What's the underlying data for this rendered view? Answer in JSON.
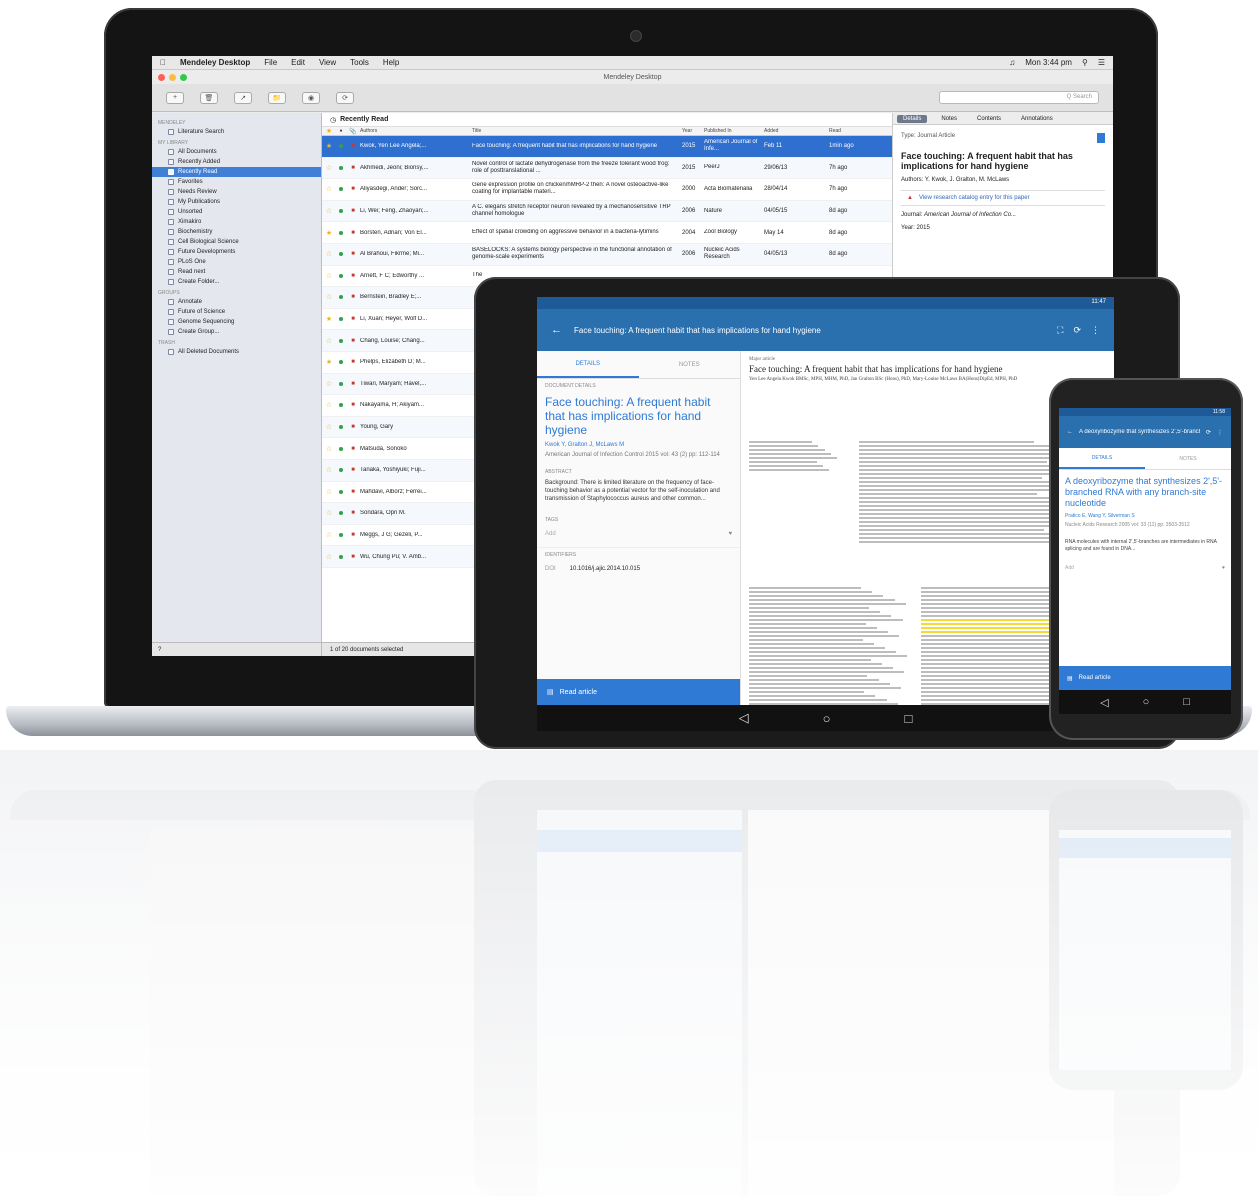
{
  "laptop": {
    "menubar": {
      "app_name": "Mendeley Desktop",
      "menus": [
        "File",
        "Edit",
        "View",
        "Tools",
        "Help"
      ],
      "clock": "Mon 3:44 pm"
    },
    "window_title": "Mendeley Desktop",
    "toolbar": {
      "search_placeholder": "Q Search",
      "labels": [
        "Documents",
        "Folders",
        "Related",
        "Sync"
      ]
    },
    "sidebar": {
      "mendeley_head": "MENDELEY",
      "literature_search": "Literature Search",
      "library_head": "MY LIBRARY",
      "items": [
        "All Documents",
        "Recently Added",
        "Recently Read",
        "Favorites",
        "Needs Review",
        "My Publications",
        "Unsorted",
        "Ximakiro",
        "Biochemistry",
        "Cell Biological Science",
        "Future Developments",
        "PLoS One",
        "Read next",
        "Create Folder..."
      ],
      "selected_index": 2,
      "groups_head": "GROUPS",
      "groups": [
        "Annotate",
        "Future of Science",
        "Genome Sequencing",
        "Create Group..."
      ],
      "trash_head": "TRASH",
      "trash_item": "All Deleted Documents"
    },
    "doclist": {
      "title": "Recently Read",
      "columns": [
        "Authors",
        "Title",
        "Year",
        "Published In",
        "Added",
        "Read"
      ],
      "rows": [
        {
          "author": "Kwok, Yen Lee Angela;...",
          "title": "Face touching: A frequent habit that has implications for hand hygiene",
          "year": "2015",
          "pub": "American Journal of Infe...",
          "added": "Feb 11",
          "read": "1min ago",
          "star": true
        },
        {
          "author": "Akhmedi, Jeoni; Bionsy,...",
          "title": "Novel control of lactate dehydrogenase from the freeze tolerant wood frog: role of posttranslational ...",
          "year": "2015",
          "pub": "PeerJ",
          "added": "29/06/13",
          "read": "7h ago",
          "star": false
        },
        {
          "author": "Aliyasdegi, Ander; Sorc...",
          "title": "Gene expression profile on chicken/hMRP-2 then: A novel osteoactive-like coating for implantable materi...",
          "year": "2000",
          "pub": "Acta Biomaterialia",
          "added": "28/04/14",
          "read": "7h ago",
          "star": false
        },
        {
          "author": "Li, Wei; Feng, Zhaoyan;...",
          "title": "A C. elegans stretch receptor neuron revealed by a mechanosensitive TRP channel homologue",
          "year": "2006",
          "pub": "Nature",
          "added": "04/05/15",
          "read": "8d ago",
          "star": false
        },
        {
          "author": "Borsten, Adrian; Von El...",
          "title": "Effect of spatial crowding on aggressive behavior in a bacteria-lytimins",
          "year": "2004",
          "pub": "Zool Biology",
          "added": "May 14",
          "read": "8d ago",
          "star": true
        },
        {
          "author": "Al Brahoui, Fikrme; Mi...",
          "title": "BASELOCKS: A systems biology perspective in the functional annotation of genome-scale experiments",
          "year": "2006",
          "pub": "Nucleic Acids Research",
          "added": "04/05/13",
          "read": "8d ago",
          "star": false
        },
        {
          "author": "Arnett, F C; Edworthy ...",
          "title": "The",
          "year": "",
          "pub": "",
          "added": "",
          "read": "",
          "star": false
        },
        {
          "author": "Bernstein, Bradley E;...",
          "title": "",
          "year": "",
          "pub": "",
          "added": "",
          "read": "",
          "star": false
        },
        {
          "author": "Li, Xuan; Heyer, Wolf D...",
          "title": "",
          "year": "",
          "pub": "",
          "added": "",
          "read": "",
          "star": true
        },
        {
          "author": "Chang, Louise; Chang...",
          "title": "",
          "year": "",
          "pub": "",
          "added": "",
          "read": "",
          "star": false
        },
        {
          "author": "Phelps, Elizabeth D; M...",
          "title": "",
          "year": "",
          "pub": "",
          "added": "",
          "read": "",
          "star": true
        },
        {
          "author": "Tiwari, Maryam; Havel,...",
          "title": "",
          "year": "",
          "pub": "",
          "added": "",
          "read": "",
          "star": false
        },
        {
          "author": "Nakayama, H; Akiyam...",
          "title": "",
          "year": "",
          "pub": "",
          "added": "",
          "read": "",
          "star": false
        },
        {
          "author": "Young, Gary",
          "title": "",
          "year": "",
          "pub": "",
          "added": "",
          "read": "",
          "star": false
        },
        {
          "author": "Matsuda, Sonoko",
          "title": "",
          "year": "",
          "pub": "",
          "added": "",
          "read": "",
          "star": false
        },
        {
          "author": "Tanaka, Yoshiyuki; Fuji...",
          "title": "",
          "year": "",
          "pub": "",
          "added": "",
          "read": "",
          "star": false
        },
        {
          "author": "Mahdavi, Alborz; Ferrei...",
          "title": "",
          "year": "",
          "pub": "",
          "added": "",
          "read": "",
          "star": false
        },
        {
          "author": "Sondara, Opri M.",
          "title": "",
          "year": "",
          "pub": "",
          "added": "",
          "read": "",
          "star": false
        },
        {
          "author": "Meggs, J G; Gezeli, P...",
          "title": "",
          "year": "",
          "pub": "",
          "added": "",
          "read": "",
          "star": false
        },
        {
          "author": "Wu, Chung Pu; V. Amb...",
          "title": "",
          "year": "",
          "pub": "",
          "added": "",
          "read": "",
          "star": false
        }
      ],
      "status": "1 of 20 documents selected"
    },
    "details": {
      "tabs": [
        "Details",
        "Notes",
        "Contents",
        "Annotations"
      ],
      "type_label": "Type:",
      "type_value": "Journal Article",
      "title": "Face touching: A frequent habit that has implications for hand hygiene",
      "authors_label": "Authors:",
      "authors_value": "Y. Kwok, J. Gralton, M. McLaws",
      "catalog_link": "View research catalog entry for this paper",
      "journal_label": "Journal:",
      "journal_value": "American Journal of Infection Co...",
      "year_label": "Year:",
      "year_value": "2015"
    }
  },
  "tablet": {
    "status_time": "11:47",
    "appbar_title": "Face touching: A frequent habit that has implications for hand hygiene",
    "tabs": [
      "DETAILS",
      "NOTES"
    ],
    "section_head": "DOCUMENT DETAILS",
    "doc_title": "Face touching: A frequent habit that has implications for hand hygiene",
    "authors": "Kwok Y, Gralton J, McLaws M",
    "source": "American Journal of Infection Control 2015 vol: 43 (2) pp: 112-114",
    "abstract_head": "ABSTRACT",
    "abstract": "Background: There is limited literature on the frequency of face-touching behavior as a potential vector for the self-inoculation and transmission of Staphylococcus aureus and other common...",
    "tags_head": "TAGS",
    "tags_placeholder": "Add",
    "identifiers_head": "IDENTIFIERS",
    "doi_label": "DOI",
    "doi_value": "10.1016/j.ajic.2014.10.015",
    "read_article": "Read article",
    "paper_kind": "Major article",
    "paper_title": "Face touching: A frequent habit that has implications for hand hygiene",
    "paper_authors": "Yen Lee Angela Kwok BMSc, MPH, MHM, PhD, Jan Gralton BSc (Hons), PhD, Mary-Louise McLaws BA(Hons)DipEd, MPH, PhD"
  },
  "phone": {
    "status_time": "11:58",
    "appbar_title": "A deoxyribozyme that synthesizes 2',5'-branched...",
    "tabs": [
      "DETAILS",
      "NOTES"
    ],
    "doc_title": "A deoxyribozyme that synthesizes 2',5'-branched RNA with any branch-site nucleotide",
    "authors": "Pratico E, Wang Y, Silverman S",
    "source": "Nucleic Acids Research 2005 vol: 33 (11) pp: 3503-3512",
    "abstract": "RNA molecules with internal 2',5'-branches are intermediates in RNA splicing and are found in DNA...",
    "tags_placeholder": "Add",
    "read_article": "Read article"
  },
  "colors": {
    "mendeley_blue": "#2f7ad4",
    "selection_blue": "#2f6fd0",
    "app_bar": "#2a6fae",
    "highlight": "#f3dc3a"
  }
}
